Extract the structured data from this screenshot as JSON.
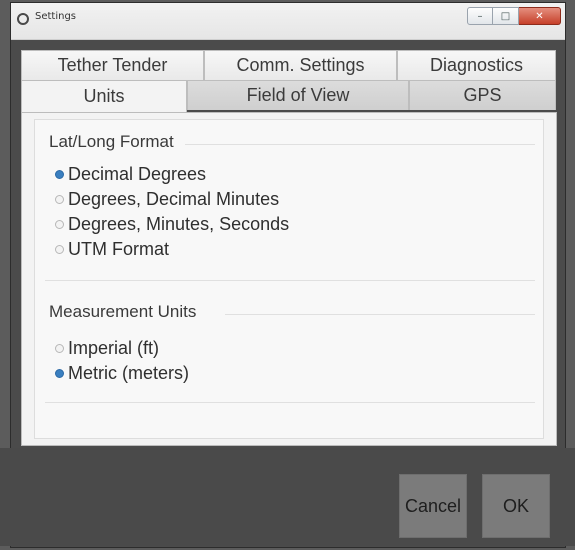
{
  "window": {
    "title": "Settings",
    "controls": {
      "minimize": "–",
      "maximize": "□",
      "close": "✕"
    }
  },
  "tabs": {
    "row1": [
      {
        "label": "Tether Tender"
      },
      {
        "label": "Comm. Settings"
      },
      {
        "label": "Diagnostics"
      }
    ],
    "row2": [
      {
        "label": "Units",
        "active": true
      },
      {
        "label": "Field of View"
      },
      {
        "label": "GPS"
      }
    ]
  },
  "latlong": {
    "title": "Lat/Long Format",
    "options": [
      {
        "label": "Decimal Degrees",
        "selected": true
      },
      {
        "label": "Degrees, Decimal Minutes",
        "selected": false
      },
      {
        "label": "Degrees, Minutes, Seconds",
        "selected": false
      },
      {
        "label": "UTM Format",
        "selected": false
      }
    ]
  },
  "measurement": {
    "title": "Measurement Units",
    "options": [
      {
        "label": "Imperial (ft)",
        "selected": false
      },
      {
        "label": "Metric (meters)",
        "selected": true
      }
    ]
  },
  "buttons": {
    "cancel": "Cancel",
    "ok": "OK"
  },
  "colors": {
    "accent": "#3a7fc0",
    "footer": "#4a4a4a",
    "close": "#c6402a"
  }
}
